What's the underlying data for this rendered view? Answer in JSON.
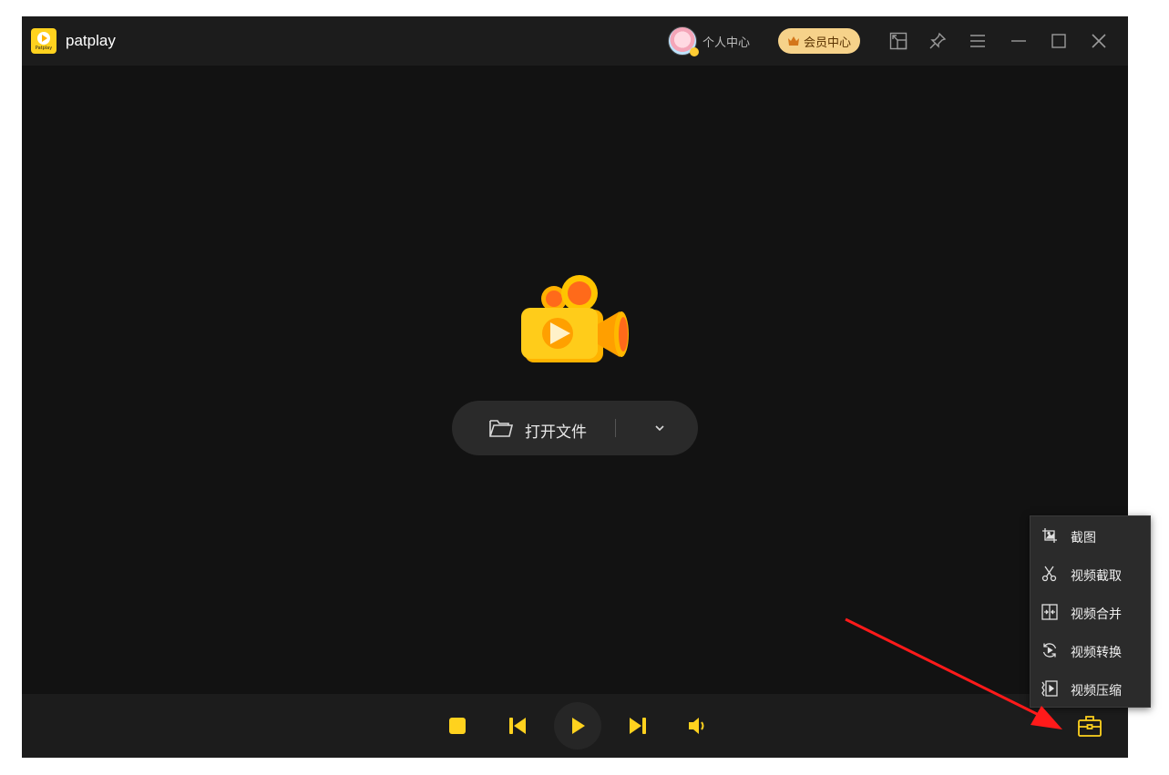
{
  "app": {
    "title": "patplay",
    "logo_text": "Patplay"
  },
  "header": {
    "user_label": "个人中心",
    "vip_label": "会员中心",
    "buttons": [
      "mini-mode",
      "pin",
      "menu",
      "minimize",
      "maximize",
      "close"
    ]
  },
  "main": {
    "open_file_label": "打开文件"
  },
  "controls": [
    "stop",
    "previous",
    "play",
    "next",
    "volume"
  ],
  "tools_menu": {
    "items": [
      {
        "label": "截图",
        "icon": "screenshot-icon"
      },
      {
        "label": "视频截取",
        "icon": "scissors-icon"
      },
      {
        "label": "视频合并",
        "icon": "merge-icon"
      },
      {
        "label": "视频转换",
        "icon": "convert-icon"
      },
      {
        "label": "视频压缩",
        "icon": "compress-icon"
      }
    ]
  },
  "colors": {
    "accent": "#FFD21E",
    "background": "#121212",
    "bar": "#1C1C1C",
    "vip": "#F6D28A",
    "annotation_arrow": "#FF1A1A"
  }
}
